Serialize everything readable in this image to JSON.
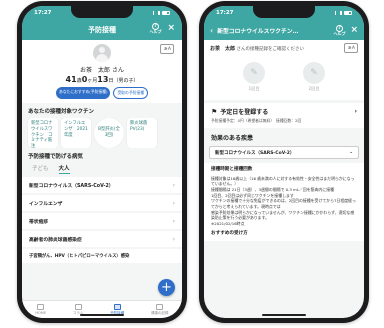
{
  "left": {
    "status_time": "17:27",
    "title": "予防接種",
    "help_label": "ヘルプ",
    "close": "×",
    "text_size": "ぁA",
    "name": "お茶　太郎",
    "name_suffix": "さん",
    "dob_age": "41",
    "dob_age_unit": "歳",
    "dob_days": "0",
    "dob_month": "6",
    "dob_day": "13",
    "dob_suffix": "日（男の子）",
    "pill_primary": "あなたにおすすめ(予防接種)",
    "pill_secondary": "受取の予防接種",
    "vaccines_title": "あなたの接種対象ワクチン",
    "vaccine_cards": [
      "新型コロナウイルスワクチン　コミナティ筋注",
      "インフルエンザ　2021年度",
      "B型肝炎(全3回)",
      "肺炎球菌　PV(23)"
    ],
    "diseases_title": "予防接種で防げる病気",
    "tab_children": "子ども",
    "tab_adults": "大人",
    "diseases": [
      "新型コロナウイルス（SARS-CoV-2）",
      "インフルエンザ",
      "帯状疱疹",
      "高齢者の肺炎球菌感染症",
      "子宮頸がん、HPV（ヒトパピローマウイルス）感染"
    ],
    "fab": "+",
    "tabbar": [
      "HOME",
      "コラム",
      "予防接種",
      "健康の記録"
    ]
  },
  "right": {
    "status_time": "17:27",
    "title": "新型コロナウイルスワクチン…",
    "help_label": "ヘルプ",
    "close": "×",
    "subject": "お茶　太郎",
    "subject_suffix": "さんの接種記録をご確認ください",
    "text_size": "ぁA",
    "dose1": "1回目",
    "dose2": "2回目",
    "schedule_label": "予定日を登録する",
    "schedule_sub": "予防接種予定：0円（希望者は無料）　接種回数：2回",
    "effects_title": "効果のある疾患",
    "select_value": "新型コロナウイルス（SARS-CoV-2）",
    "info_heading": "接種時期と接種回数",
    "info_lines": [
      "接種対象は16歳以上（16 歳未満の人に対する有効性・安全性はまだ明らかになっていません。）",
      "接種間隔は 21日（3週）、3週間の間隔で 0.3 mL／回を筋肉内に接種",
      "1回目、2回目は必ず同じワクチンを接種します",
      "ワクチンの接種で十分な免疫ができるのは、2回目の接種を受けてから7日程度経ってからと考えられています。現時点では",
      "感染予防効果は明らかになっていませんが、ワクチン接種にかかわらず、適切な感染防止策を行う必要があります。",
      "※2021/02/16時点"
    ],
    "faq_title": "おすすめの受け方"
  }
}
